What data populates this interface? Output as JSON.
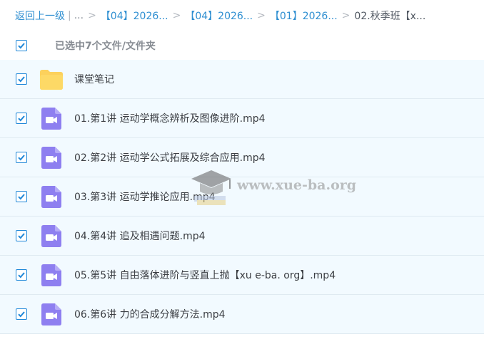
{
  "breadcrumb": {
    "back": "返回上一级",
    "ellipsis": "...",
    "items": [
      "【04】2026...",
      "【04】2026...",
      "【01】2026..."
    ],
    "current": "02.秋季班【x..."
  },
  "selection": {
    "summary": "已选中7个文件/文件夹",
    "all_checked": true
  },
  "files": [
    {
      "name": "课堂笔记",
      "type": "folder",
      "checked": true
    },
    {
      "name": "01.第1讲 运动学概念辨析及图像进阶.mp4",
      "type": "video",
      "checked": true
    },
    {
      "name": "02.第2讲 运动学公式拓展及综合应用.mp4",
      "type": "video",
      "checked": true
    },
    {
      "name": "03.第3讲 运动学推论应用.mp4",
      "type": "video",
      "checked": true
    },
    {
      "name": "04.第4讲 追及相遇问题.mp4",
      "type": "video",
      "checked": true
    },
    {
      "name": "05.第5讲 自由落体进阶与竖直上抛【xu e-ba. org】.mp4",
      "type": "video",
      "checked": true
    },
    {
      "name": "06.第6讲 力的合成分解方法.mp4",
      "type": "video",
      "checked": true
    }
  ],
  "watermark": {
    "text": "www.xue-ba.org"
  },
  "colors": {
    "link": "#2f8fd1",
    "row_bg": "#f2faff",
    "checkbox": "#1f87d8",
    "folder": "#fcd15c",
    "video": "#8e7ff0"
  },
  "icons": {
    "folder": "folder-icon",
    "video": "video-file-icon",
    "check": "check-icon"
  }
}
